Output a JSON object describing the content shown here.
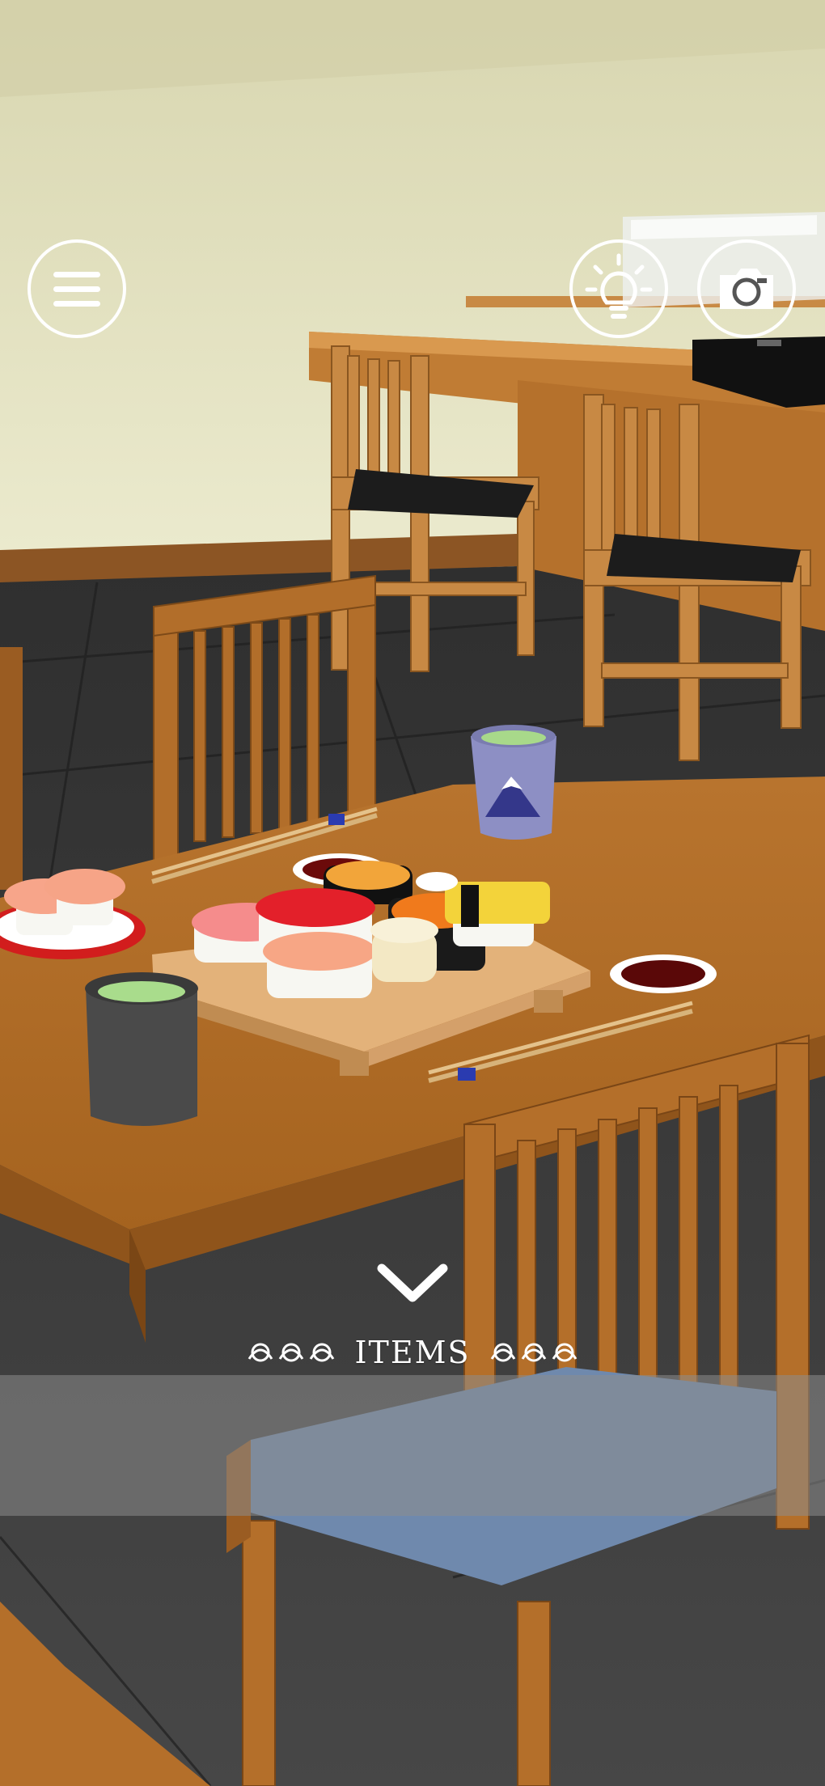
{
  "hud": {
    "menu_icon": "hamburger-icon",
    "hint_icon": "lightbulb-icon",
    "camera_icon": "camera-icon"
  },
  "inventory": {
    "label": "ITEMS",
    "toggle_icon": "chevron-down-icon",
    "ornament_icon": "swirl-ornament-icon",
    "slots": []
  },
  "colors": {
    "wall": "#e6e3c2",
    "floor": "#3b3b3b",
    "wood": "#b9732c",
    "hud_white": "#ffffff",
    "items_bar": "#8c8c8c"
  }
}
